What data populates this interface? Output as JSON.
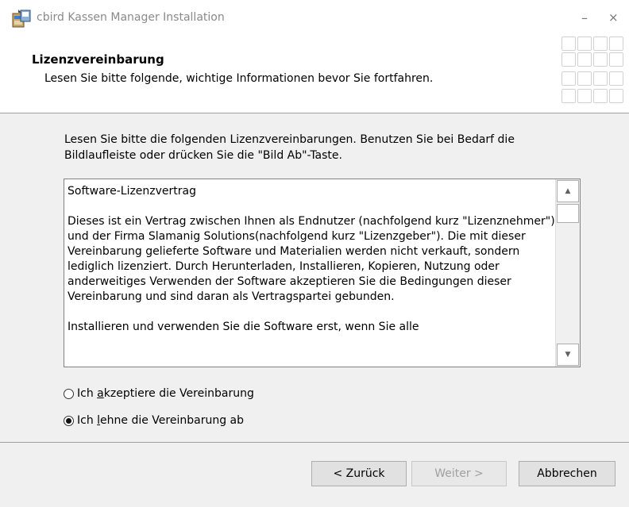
{
  "window": {
    "title": "cbird Kassen Manager Installation",
    "minimize_symbol": "–",
    "close_symbol": "×",
    "icon": "installer-package-icon"
  },
  "header": {
    "title": "Lizenzvereinbarung",
    "subtitle": "Lesen Sie bitte folgende, wichtige Informationen bevor Sie fortfahren."
  },
  "main": {
    "intro": "Lesen Sie bitte die folgenden Lizenzvereinbarungen. Benutzen Sie bei Bedarf die Bildlaufleiste oder drücken Sie die \"Bild Ab\"-Taste.",
    "license_paragraphs": [
      "Software-Lizenzvertrag",
      "Dieses ist ein Vertrag zwischen Ihnen als Endnutzer (nachfolgend kurz \"Lizenznehmer\") und der Firma Slamanig Solutions(nachfolgend kurz \"Lizenzgeber\"). Die mit dieser Vereinbarung gelieferte Software und Materialien werden nicht verkauft, sondern lediglich lizenziert. Durch Herunterladen, Installieren, Kopieren, Nutzung oder anderweitiges Verwenden der Software akzeptieren Sie die Bedingungen dieser Vereinbarung und sind daran als Vertragspartei gebunden.",
      "Installieren und verwenden Sie die Software erst, wenn Sie alle"
    ],
    "scroll_up_symbol": "▲",
    "scroll_down_symbol": "▼",
    "radio_accept": {
      "before": "Ich ",
      "accel": "a",
      "after": "kzeptiere die Vereinbarung",
      "checked": false
    },
    "radio_decline": {
      "before": "Ich ",
      "accel": "l",
      "after": "ehne die Vereinbarung ab",
      "checked": true
    }
  },
  "buttons": {
    "back": "< Zurück",
    "next": "Weiter >",
    "cancel": "Abbrechen"
  }
}
